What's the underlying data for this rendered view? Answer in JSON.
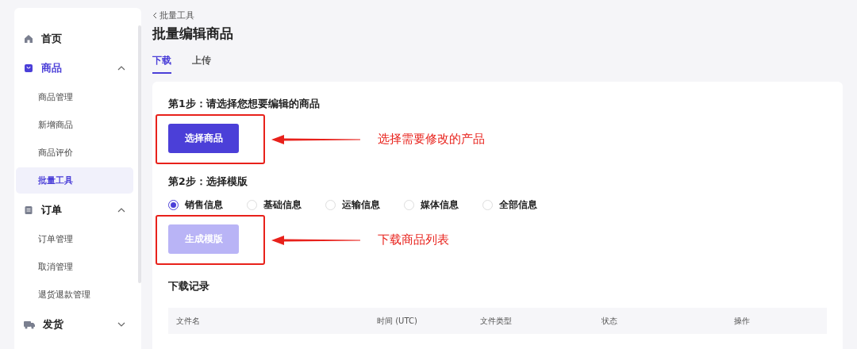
{
  "sidebar": {
    "items": [
      {
        "label": "首页",
        "kind": "link",
        "selected": false
      },
      {
        "label": "商品",
        "kind": "group",
        "selected": true,
        "expanded": true,
        "children": [
          {
            "label": "商品管理",
            "selected": false
          },
          {
            "label": "新增商品",
            "selected": false
          },
          {
            "label": "商品评价",
            "selected": false
          },
          {
            "label": "批量工具",
            "selected": true
          }
        ]
      },
      {
        "label": "订单",
        "kind": "group",
        "selected": false,
        "expanded": true,
        "children": [
          {
            "label": "订单管理",
            "selected": false
          },
          {
            "label": "取消管理",
            "selected": false
          },
          {
            "label": "退货退款管理",
            "selected": false
          }
        ]
      },
      {
        "label": "发货",
        "kind": "group",
        "selected": false,
        "expanded": false
      }
    ]
  },
  "breadcrumb": "批量工具",
  "title": "批量编辑商品",
  "tabs": [
    {
      "label": "下载",
      "selected": true
    },
    {
      "label": "上传",
      "selected": false
    }
  ],
  "steps": [
    {
      "label": "第1步：请选择您想要编辑的商品",
      "button": {
        "label": "选择商品",
        "disabled": false
      },
      "annotation": "选择需要修改的产品"
    },
    {
      "label": "第2步：选择模版",
      "options": [
        {
          "label": "销售信息",
          "selected": true
        },
        {
          "label": "基础信息",
          "selected": false
        },
        {
          "label": "运输信息",
          "selected": false
        },
        {
          "label": "媒体信息",
          "selected": false
        },
        {
          "label": "全部信息",
          "selected": false
        }
      ],
      "button": {
        "label": "生成模版",
        "disabled": true
      },
      "annotation": "下载商品列表"
    }
  ],
  "records": {
    "title": "下载记录",
    "columns": [
      "文件名",
      "时间 (UTC)",
      "文件类型",
      "状态",
      "操作"
    ]
  }
}
